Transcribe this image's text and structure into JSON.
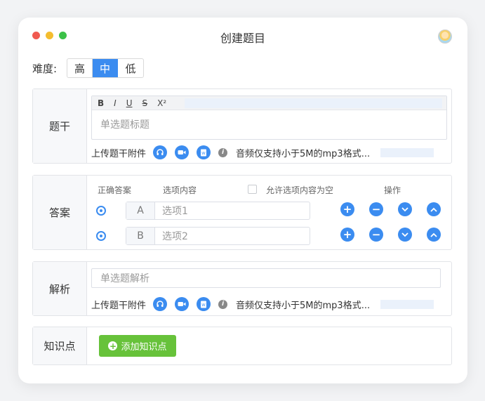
{
  "window": {
    "title": "创建题目"
  },
  "difficulty": {
    "label": "难度:",
    "options": [
      "高",
      "中",
      "低"
    ],
    "selected": "中"
  },
  "stem": {
    "label": "题干",
    "toolbar": [
      "B",
      "I",
      "U",
      "S",
      "X²"
    ],
    "placeholder": "单选题标题",
    "upload_label": "上传题干附件",
    "upload_note": "音频仅支持小于5M的mp3格式..."
  },
  "answer": {
    "label": "答案",
    "headers": {
      "correct": "正确答案",
      "content": "选项内容",
      "allow_empty": "允许选项内容为空",
      "actions": "操作"
    },
    "options": [
      {
        "letter": "A",
        "placeholder": "选项1"
      },
      {
        "letter": "B",
        "placeholder": "选项2"
      }
    ]
  },
  "analysis": {
    "label": "解析",
    "placeholder": "单选题解析",
    "upload_label": "上传题干附件",
    "upload_note": "音频仅支持小于5M的mp3格式..."
  },
  "knowledge": {
    "label": "知识点",
    "add_button": "添加知识点"
  },
  "colors": {
    "accent": "#3b8cf0",
    "success": "#67c23a"
  }
}
